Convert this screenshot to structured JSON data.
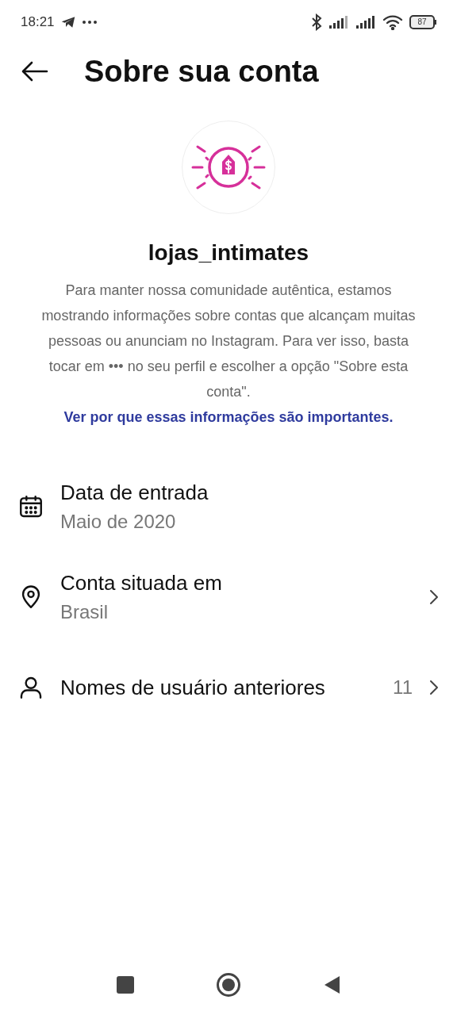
{
  "status_bar": {
    "time": "18:21",
    "battery": "87"
  },
  "header": {
    "title": "Sobre sua conta"
  },
  "profile": {
    "username": "lojas_intimates",
    "description": "Para manter nossa comunidade autêntica, estamos mostrando informações sobre contas que alcançam muitas pessoas ou anunciam no Instagram. Para ver isso, basta tocar em ••• no seu perfil e escolher a opção \"Sobre esta conta\".",
    "link": "Ver por que essas informações são importantes."
  },
  "items": [
    {
      "kind": "date",
      "title": "Data de entrada",
      "subtitle": "Maio de 2020"
    },
    {
      "kind": "location",
      "title": "Conta situada em",
      "subtitle": "Brasil"
    },
    {
      "kind": "usernames",
      "title": "Nomes de usuário anteriores",
      "count": "11"
    }
  ]
}
